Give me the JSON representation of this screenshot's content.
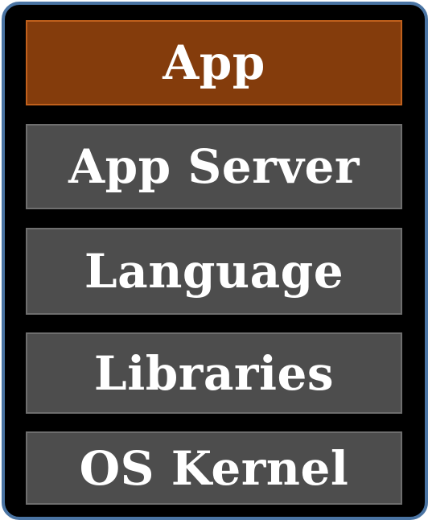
{
  "stack": {
    "layers": [
      {
        "label": "App",
        "color": "#843c0c"
      },
      {
        "label": "App Server",
        "color": "#4d4d4d"
      },
      {
        "label": "Language",
        "color": "#4d4d4d"
      },
      {
        "label": "Libraries",
        "color": "#4d4d4d"
      },
      {
        "label": "OS Kernel",
        "color": "#4d4d4d"
      }
    ],
    "frame_color": "#4a74a3",
    "background": "#000000"
  }
}
